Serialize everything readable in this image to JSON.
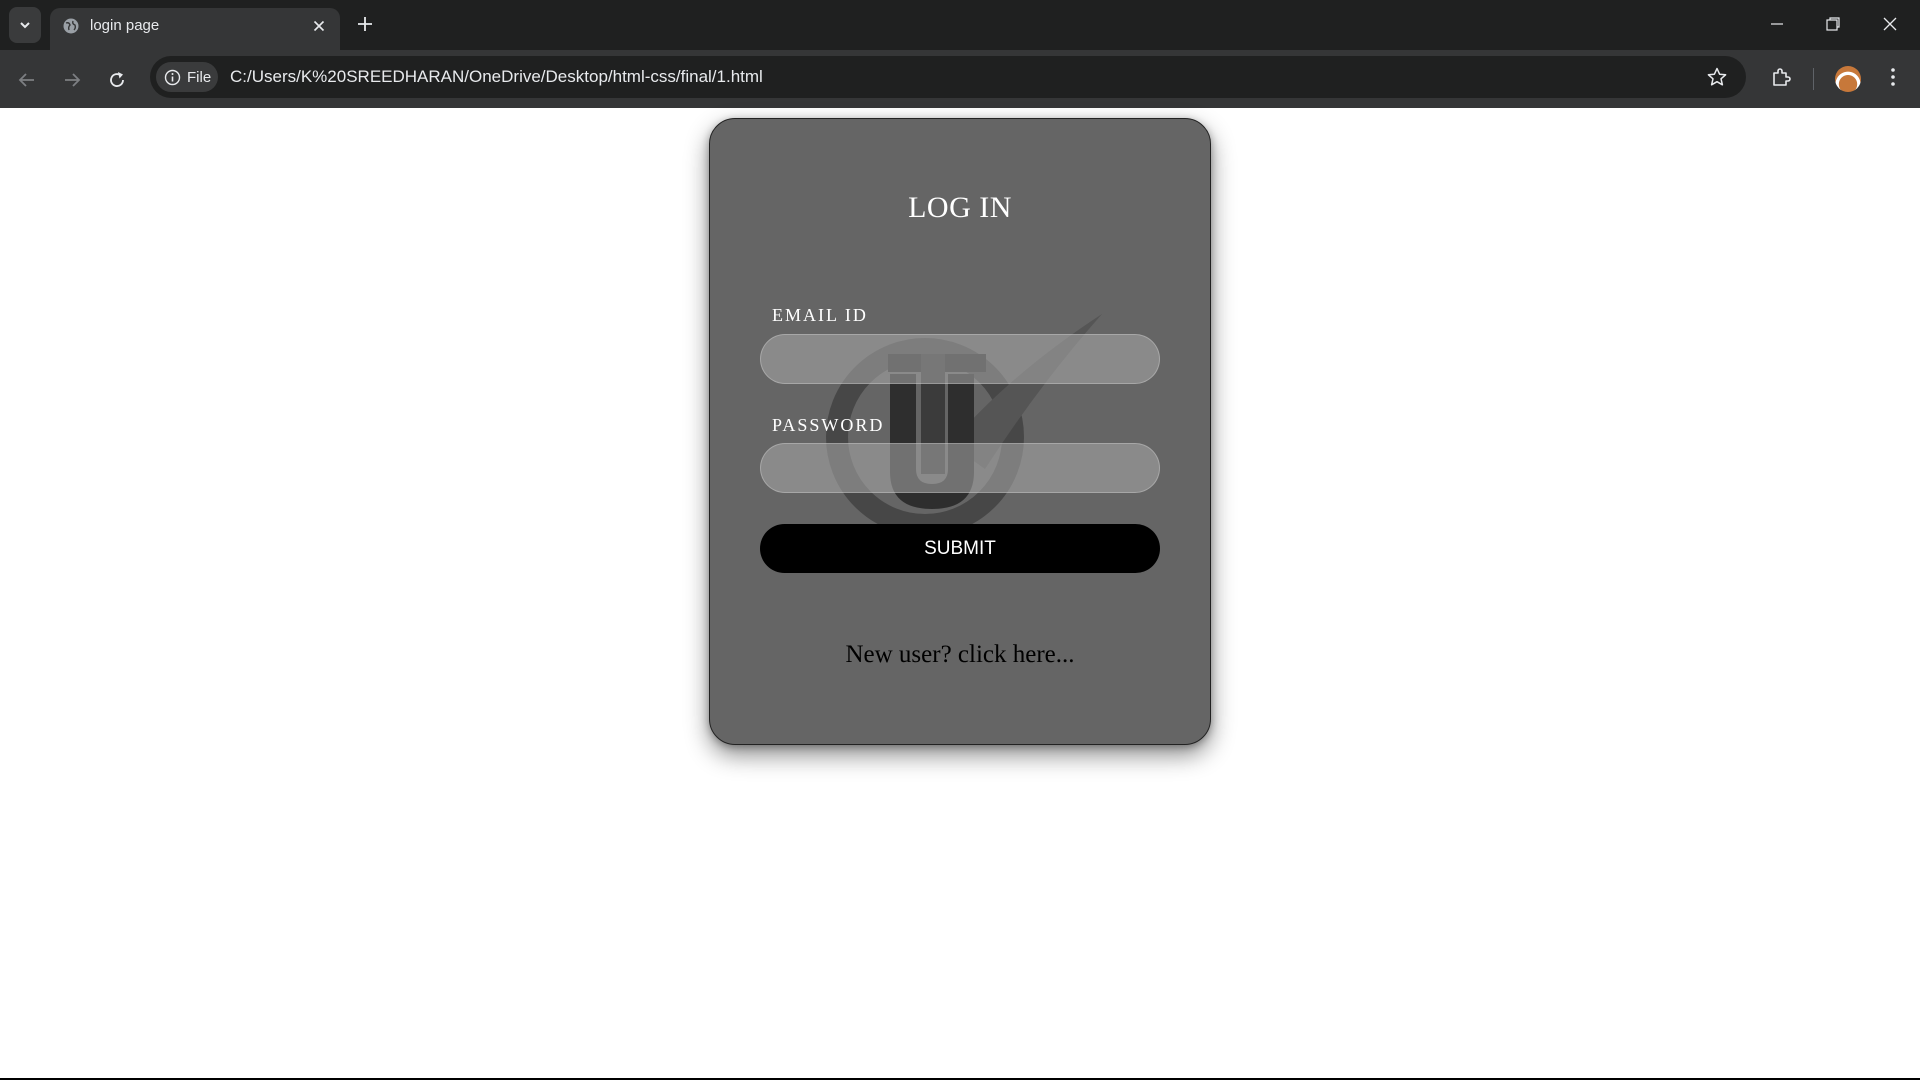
{
  "browser": {
    "tab": {
      "title": "login page"
    },
    "omnibox": {
      "chip_label": "File",
      "url": "C:/Users/K%20SREEDHARAN/OneDrive/Desktop/html-css/final/1.html"
    },
    "icons": [
      "tab-list-icon",
      "globe-icon",
      "close-icon",
      "plus-icon",
      "minimize-icon",
      "restore-icon",
      "window-close-icon",
      "back-icon",
      "forward-icon",
      "reload-icon",
      "info-icon",
      "star-icon",
      "extensions-icon",
      "menu-icon"
    ]
  },
  "login": {
    "title": "LOG IN",
    "email_label": "EMAIL ID",
    "password_label": "PASSWORD",
    "submit_label": "SUBMIT",
    "new_user_link": "New user? click here..."
  },
  "colors": {
    "card_bg": "#656565",
    "button_bg": "#000000",
    "input_bg": "#a8a8a8",
    "page_bg": "#ffffff"
  }
}
